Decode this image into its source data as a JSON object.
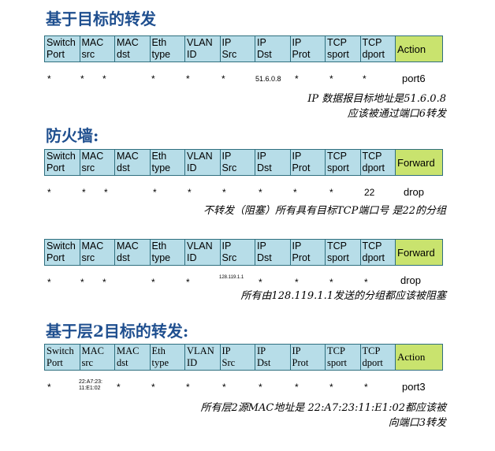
{
  "sections": [
    {
      "title": "基于目标的转发",
      "headers": [
        [
          "Switch",
          "Port"
        ],
        [
          "MAC",
          "src"
        ],
        [
          "MAC",
          "dst"
        ],
        [
          "Eth",
          "type"
        ],
        [
          "VLAN",
          "ID"
        ],
        [
          "IP",
          "Src"
        ],
        [
          "IP",
          "Dst"
        ],
        [
          "IP",
          "Prot"
        ],
        [
          "TCP",
          "sport"
        ],
        [
          "TCP",
          "dport"
        ]
      ],
      "action_label": "Action",
      "values": [
        "*",
        "*",
        "*",
        "*",
        "*",
        "*",
        "51.6.0.8",
        "*",
        "*",
        "*"
      ],
      "action_value": "port6",
      "note_lines": [
        "IP 数据报目标地址是51.6.0.8",
        "应该被通过端口6转发"
      ]
    },
    {
      "title": "防火墙:",
      "headers": [
        [
          "Switch",
          "Port"
        ],
        [
          "MAC",
          "src"
        ],
        [
          "MAC",
          "dst"
        ],
        [
          "Eth",
          "type"
        ],
        [
          "VLAN",
          "ID"
        ],
        [
          "IP",
          "Src"
        ],
        [
          "IP",
          "Dst"
        ],
        [
          "IP",
          "Prot"
        ],
        [
          "TCP",
          "sport"
        ],
        [
          "TCP",
          "dport"
        ]
      ],
      "action_label": "Forward",
      "values": [
        "*",
        "*",
        "*",
        "*",
        "*",
        "*",
        "*",
        "*",
        "*",
        "22"
      ],
      "action_value": "drop",
      "note_lines": [
        "不转发（阻塞）所有具有目标TCP端口号 是22的分组"
      ]
    },
    {
      "title": "",
      "headers": [
        [
          "Switch",
          "Port"
        ],
        [
          "MAC",
          "src"
        ],
        [
          "MAC",
          "dst"
        ],
        [
          "Eth",
          "type"
        ],
        [
          "VLAN",
          "ID"
        ],
        [
          "IP",
          "Src"
        ],
        [
          "IP",
          "Dst"
        ],
        [
          "IP",
          "Prot"
        ],
        [
          "TCP",
          "sport"
        ],
        [
          "TCP",
          "dport"
        ]
      ],
      "action_label": "Forward",
      "values": [
        "*",
        "*",
        "*",
        "*",
        "*",
        "128.119.1.1",
        "*",
        "*",
        "*",
        "*"
      ],
      "action_value": "drop",
      "note_lines": [
        "所有由128.119.1.1发送的分组都应该被阻塞"
      ]
    },
    {
      "title": "基于层2目标的转发:",
      "headers": [
        [
          "Switch",
          "Port"
        ],
        [
          "MAC",
          "src"
        ],
        [
          "MAC",
          "dst"
        ],
        [
          "Eth",
          "type"
        ],
        [
          "VLAN",
          "ID"
        ],
        [
          "IP",
          "Src"
        ],
        [
          "IP",
          "Dst"
        ],
        [
          "IP",
          "Prot"
        ],
        [
          "TCP",
          "sport"
        ],
        [
          "TCP",
          "dport"
        ]
      ],
      "action_label": "Action",
      "values": [
        "*",
        "22:A7:23:\n11:E1:02",
        "*",
        "*",
        "*",
        "*",
        "*",
        "*",
        "*",
        "*"
      ],
      "action_value": "port3",
      "note_lines": [
        "所有层2源MAC地址是 22:A7:23:11:E1:02都应该被",
        "向端口3转发"
      ]
    }
  ]
}
